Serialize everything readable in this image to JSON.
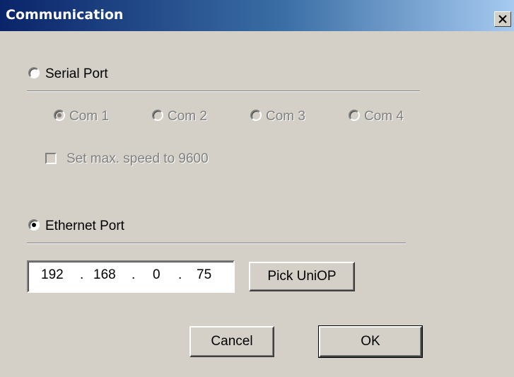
{
  "window": {
    "title": "Communication"
  },
  "serial": {
    "label": "Serial Port",
    "selected": false,
    "com_ports": [
      {
        "label": "Com 1",
        "selected": true
      },
      {
        "label": "Com 2",
        "selected": false
      },
      {
        "label": "Com 3",
        "selected": false
      },
      {
        "label": "Com 4",
        "selected": false
      }
    ],
    "max_speed_label": "Set max. speed to 9600",
    "max_speed_checked": false,
    "enabled": false
  },
  "ethernet": {
    "label": "Ethernet Port",
    "selected": true,
    "ip": [
      "192",
      "168",
      "0",
      "75"
    ],
    "ip_separator": ".",
    "pick_button": "Pick UniOP"
  },
  "buttons": {
    "cancel": "Cancel",
    "ok": "OK"
  },
  "colors": {
    "title_start": "#0a246a",
    "title_end": "#a6caf0",
    "face": "#d4d0c8"
  }
}
